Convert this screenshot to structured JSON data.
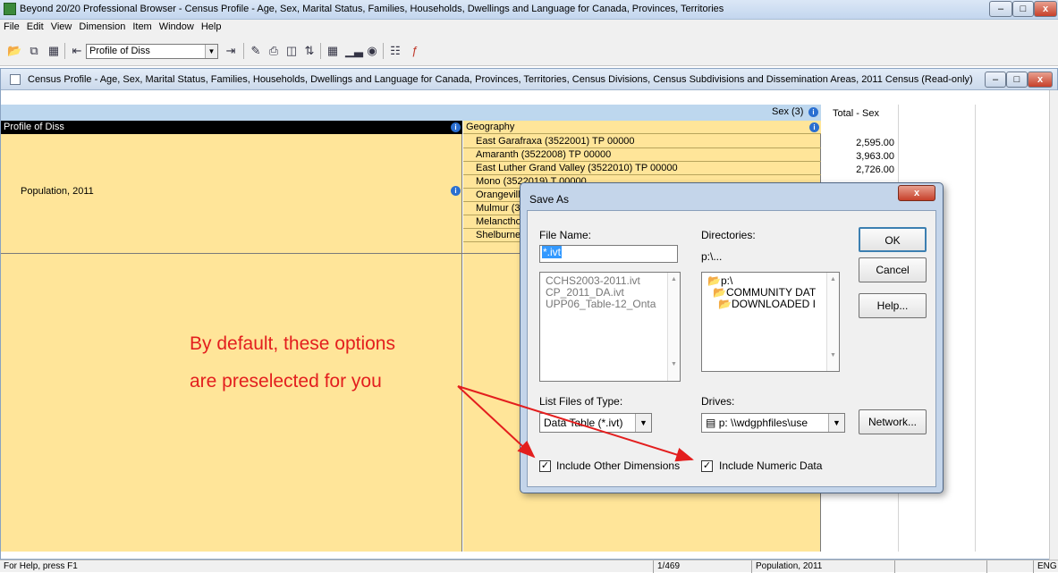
{
  "window": {
    "title": "Beyond 20/20 Professional Browser - Census Profile - Age, Sex, Marital Status, Families, Households, Dwellings and Language for Canada, Provinces, Territories",
    "minimize": "–",
    "maximize": "□",
    "close": "x"
  },
  "menu": [
    "File",
    "Edit",
    "View",
    "Dimension",
    "Item",
    "Window",
    "Help"
  ],
  "toolbar": {
    "combo_value": "Profile of Diss"
  },
  "child_window": {
    "title": "Census Profile - Age, Sex, Marital Status, Families, Households, Dwellings and Language for Canada, Provinces, Territories, Census Divisions, Census Subdivisions and Dissemination Areas, 2011 Census (Read-only)"
  },
  "table": {
    "sex_header": "Sex (3)",
    "total_sex_header": "Total - Sex",
    "left_header": "Profile of Diss",
    "geography_header": "Geography",
    "row_label": "Population, 2011",
    "geographies": [
      "East Garafraxa (3522001) TP 00000",
      "Amaranth (3522008) TP 00000",
      "East Luther Grand Valley (3522010) TP 00000",
      "Mono (3522019) T 00000",
      "Orangeville",
      "Mulmur (3",
      "Melancthon",
      "Shelburne"
    ],
    "values": [
      "2,595.00",
      "3,963.00",
      "2,726.00"
    ]
  },
  "statusbar": {
    "help": "For Help, press F1",
    "page": "1/469",
    "current": "Population, 2011",
    "lang": "ENG"
  },
  "dialog": {
    "title": "Save As",
    "close": "x",
    "file_name_label": "File Name:",
    "file_name_value": "*.ivt",
    "files": [
      "CCHS2003-2011.ivt",
      "CP_2011_DA.ivt",
      "UPP06_Table-12_Onta"
    ],
    "directories_label": "Directories:",
    "current_dir": "p:\\...",
    "dirs": [
      "p:\\",
      "COMMUNITY DAT",
      "DOWNLOADED I"
    ],
    "list_type_label": "List Files of Type:",
    "list_type_value": "Data Table (*.ivt)",
    "drives_label": "Drives:",
    "drives_value": "p: \\\\wdgphfiles\\use",
    "ok": "OK",
    "cancel": "Cancel",
    "help": "Help...",
    "network": "Network...",
    "include_other_dims": "Include Other Dimensions",
    "include_numeric": "Include Numeric Data"
  },
  "annotation": {
    "line1": "By default, these options",
    "line2": "are preselected for you",
    "color": "#e31e1e"
  }
}
